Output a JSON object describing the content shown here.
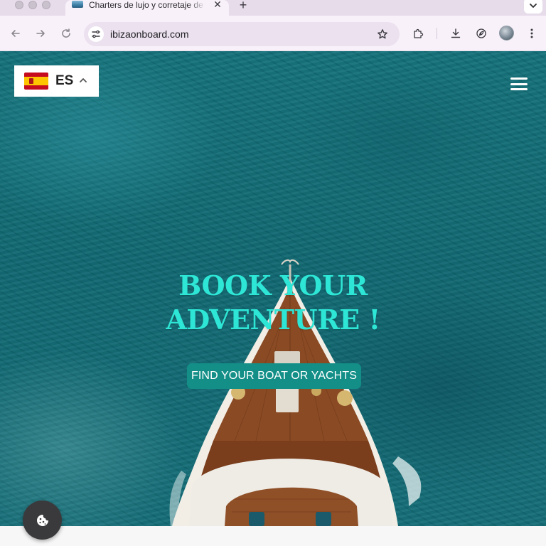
{
  "browser": {
    "tab": {
      "title": "Charters de lujo y corretaje de",
      "favicon": "ibiza-boat-favicon-icon",
      "close_icon": "close-icon"
    },
    "new_tab_icon": "plus-icon",
    "tab_menu_icon": "chevron-down-icon",
    "toolbar": {
      "back_icon": "arrow-left-icon",
      "forward_icon": "arrow-right-icon",
      "reload_icon": "reload-icon",
      "site_info_icon": "tune-icon",
      "url": "ibizaonboard.com",
      "bookmark_icon": "star-icon",
      "extensions_icon": "puzzle-icon",
      "downloads_icon": "download-icon",
      "performance_icon": "leaf-icon",
      "profile_icon": "avatar",
      "menu_icon": "kebab-menu-icon"
    },
    "colors": {
      "chrome": "#f8f1fa",
      "tabstrip": "#e7dcea"
    }
  },
  "page": {
    "language": {
      "code": "ES",
      "flag_icon": "spain-flag-icon",
      "chevron_icon": "chevron-up-icon"
    },
    "menu_icon": "hamburger-icon",
    "hero": {
      "title_line1": "BOOK YOUR",
      "title_line2": "ADVENTURE",
      "title_exclaim": "!",
      "cta_label": "FIND YOUR BOAT OR YACHTS"
    },
    "cookie_icon": "cookie-icon",
    "colors": {
      "title": "#2ee6d6",
      "cta_bg": "#138f88",
      "sea": "#0f6770"
    }
  }
}
